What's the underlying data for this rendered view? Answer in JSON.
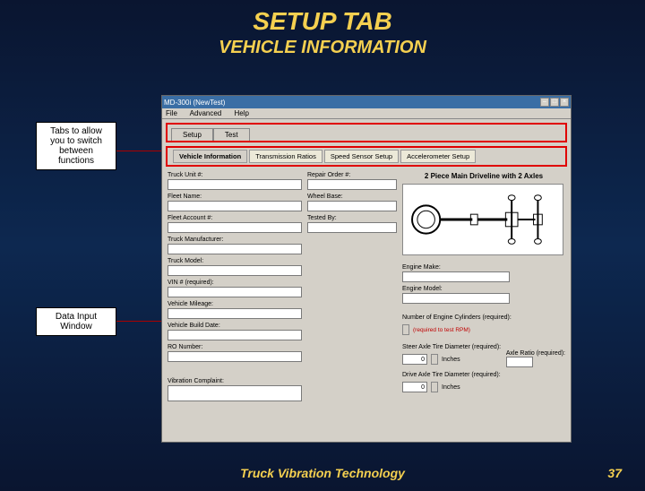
{
  "slide": {
    "title1": "SETUP TAB",
    "title2": "VEHICLE INFORMATION",
    "footer": "Truck Vibration Technology",
    "page": "37"
  },
  "callouts": {
    "tabs": "Tabs to allow you to switch between functions",
    "data": "Data Input Window"
  },
  "window": {
    "title": "MD-300i (NewTest)",
    "menu": {
      "file": "File",
      "advanced": "Advanced",
      "help": "Help"
    },
    "close": "×",
    "max": "□",
    "min": "–"
  },
  "maintabs": {
    "setup": "Setup",
    "test": "Test"
  },
  "subtabs": {
    "vehicle": "Vehicle Information",
    "trans": "Transmission Ratios",
    "speed": "Speed Sensor Setup",
    "accel": "Accelerometer Setup"
  },
  "fields": {
    "truck_unit": "Truck Unit #:",
    "fleet_name": "Fleet Name:",
    "fleet_account": "Fleet Account #:",
    "truck_mfr": "Truck Manufacturer:",
    "truck_model": "Truck Model:",
    "vin": "VIN # (required):",
    "mileage": "Vehicle Mileage:",
    "build_date": "Vehicle Build Date:",
    "ro": "RO Number:",
    "complaint": "Vibration Complaint:",
    "repair_order": "Repair Order #:",
    "wheel_base": "Wheel Base:",
    "tested_by": "Tested By:"
  },
  "right": {
    "diagram_title": "2 Piece Main Driveline with 2 Axles",
    "engine_make": "Engine Make:",
    "engine_model": "Engine Model:",
    "num_cyl": "Number of Engine Cylinders (required):",
    "num_cyl_note": "(required to test RPM)",
    "steer_dia": "Steer Axle Tire Diameter (required):",
    "drive_dia": "Drive Axle Tire Diameter (required):",
    "axle_ratio": "Axle Ratio (required):",
    "steer_val": "0",
    "drive_val": "0",
    "unit": "Inches"
  }
}
